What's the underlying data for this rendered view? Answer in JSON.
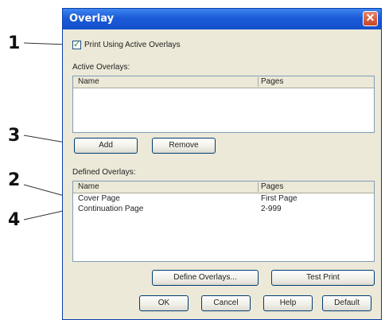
{
  "callouts": [
    "1",
    "3",
    "2",
    "4"
  ],
  "dialog": {
    "title": "Overlay",
    "close_glyph": "✕",
    "print_using_label": "Print Using Active Overlays",
    "print_using_checked": true,
    "active_section_label": "Active Overlays:",
    "active_columns": [
      "Name",
      "Pages"
    ],
    "add_label": "Add",
    "remove_label": "Remove",
    "defined_section_label": "Defined Overlays:",
    "defined_columns": [
      "Name",
      "Pages"
    ],
    "defined_rows": [
      {
        "name": "Cover Page",
        "pages": "First Page"
      },
      {
        "name": "Continuation Page",
        "pages": "2-999"
      }
    ],
    "define_overlays_label": "Define Overlays...",
    "test_print_label": "Test Print",
    "ok_label": "OK",
    "cancel_label": "Cancel",
    "help_label": "Help",
    "default_label": "Default"
  }
}
